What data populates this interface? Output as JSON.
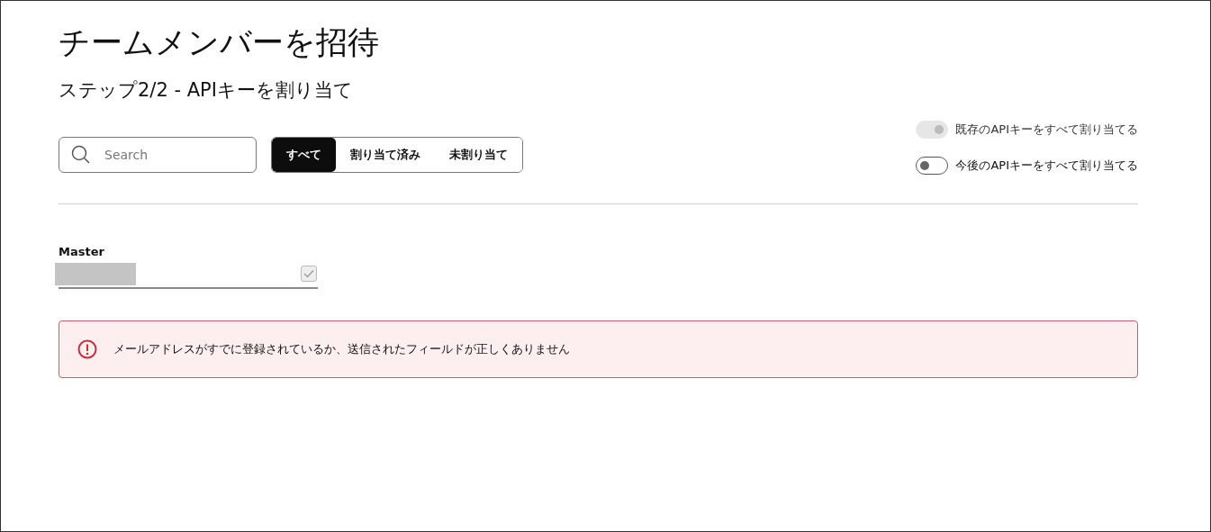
{
  "title": "チームメンバーを招待",
  "subtitle": "ステップ2/2 - APIキーを割り当て",
  "search": {
    "placeholder": "Search"
  },
  "filters": [
    {
      "label": "すべて",
      "selected": true
    },
    {
      "label": "割り当て済み",
      "selected": false
    },
    {
      "label": "未割り当て",
      "selected": false
    }
  ],
  "toggles": [
    {
      "label": "既存のAPIキーをすべて割り当てる",
      "on": true,
      "disabled": true
    },
    {
      "label": "今後のAPIキーをすべて割り当てる",
      "on": false,
      "disabled": false
    }
  ],
  "key_item": {
    "label": "Master",
    "checked": true,
    "disabled": true
  },
  "error": {
    "message": "メールアドレスがすでに登録されているか、送信されたフィールドが正しくありません"
  }
}
